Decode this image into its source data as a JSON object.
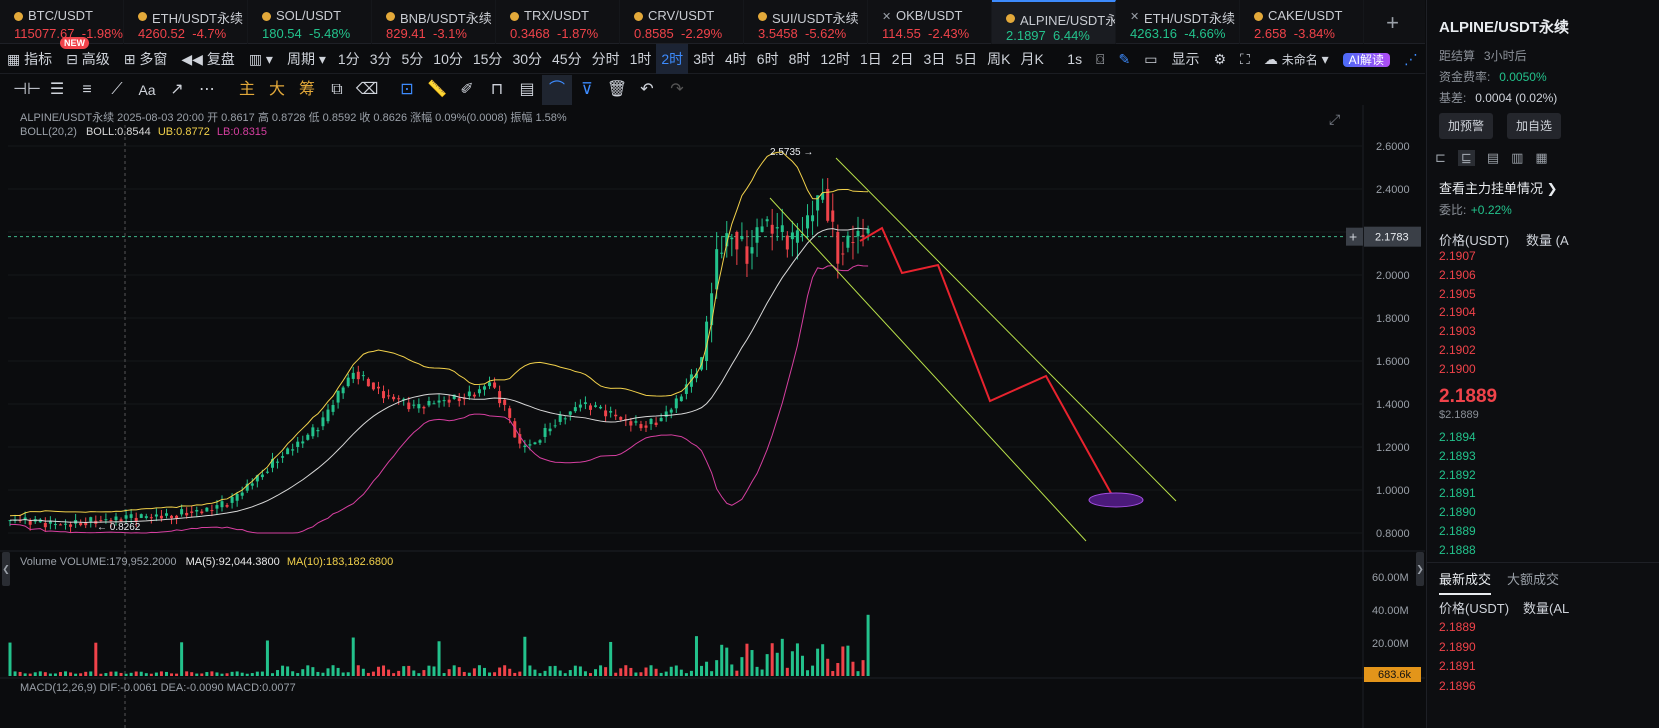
{
  "tickers": [
    {
      "sym": "BTC/USDT",
      "price": "115077.67",
      "chg": "-1.98%",
      "dir": "dn"
    },
    {
      "sym": "ETH/USDT永续",
      "price": "4260.52",
      "chg": "-4.7%",
      "dir": "dn"
    },
    {
      "sym": "SOL/USDT",
      "price": "180.54",
      "chg": "-5.48%",
      "dir": "up"
    },
    {
      "sym": "BNB/USDT永续",
      "price": "829.41",
      "chg": "-3.1%",
      "dir": "dn"
    },
    {
      "sym": "TRX/USDT",
      "price": "0.3468",
      "chg": "-1.87%",
      "dir": "dn"
    },
    {
      "sym": "CRV/USDT",
      "price": "0.8585",
      "chg": "-2.29%",
      "dir": "dn"
    },
    {
      "sym": "SUI/USDT永续",
      "price": "3.5458",
      "chg": "-5.62%",
      "dir": "dn"
    },
    {
      "sym": "OKB/USDT",
      "price": "114.55",
      "chg": "-2.43%",
      "dir": "dn"
    },
    {
      "sym": "ALPINE/USDT永续",
      "price": "2.1897",
      "chg": "6.44%",
      "dir": "up"
    },
    {
      "sym": "ETH/USDT永续",
      "price": "4263.16",
      "chg": "-4.66%",
      "dir": "up"
    },
    {
      "sym": "CAKE/USDT",
      "price": "2.658",
      "chg": "-3.84%",
      "dir": "dn"
    }
  ],
  "toolbar": {
    "indicators": "指标",
    "new_badge": "NEW",
    "advanced": "高级",
    "multiwin": "多窗",
    "replay": "复盘",
    "period": "周期",
    "intervals": [
      "1分",
      "3分",
      "5分",
      "10分",
      "15分",
      "30分",
      "45分",
      "分时",
      "1时",
      "2时",
      "3时",
      "4时",
      "6时",
      "8时",
      "12时",
      "1日",
      "2日",
      "3日",
      "5日",
      "周K",
      "月K"
    ],
    "active_interval": "2时",
    "sec": "1s",
    "display": "显示",
    "unnamed": "未命名",
    "ai": "AI解读"
  },
  "drawtools": {
    "zhu": "主",
    "da": "大",
    "chou": "筹",
    "aa": "Aa"
  },
  "legend": {
    "line1": "ALPINE/USDT永续  2025-08-03 20:00  开 0.8617  高 0.8728  低 0.8592  收 0.8626  涨幅 0.09%(0.0008)  振幅 1.58%",
    "boll": "BOLL(20,2)",
    "boll_mid": "BOLL:0.8544",
    "boll_ub": "UB:0.8772",
    "boll_lb": "LB:0.8315",
    "vol": "Volume  VOLUME:179,952.2000",
    "ma5": "MA(5):92,044.3800",
    "ma10": "MA(10):183,182.6800",
    "macd": "MACD(12,26,9)  DIF:-0.0061  DEA:-0.0090  MACD:0.0077"
  },
  "chart_labels": {
    "high": "2.5735 →",
    "low": "← 0.8262",
    "current": "2.1783",
    "vol_last": "683.6k"
  },
  "price_axis": [
    "2.6000",
    "2.4000",
    "2.2000",
    "2.0000",
    "1.8000",
    "1.6000",
    "1.4000",
    "1.2000",
    "1.0000",
    "0.8000"
  ],
  "vol_axis": [
    "60.00M",
    "40.00M",
    "20.00M"
  ],
  "colors": {
    "up": "#23c28c",
    "down": "#f0434a",
    "accent": "#3d8bfd",
    "boll_ub": "#f2d14b",
    "boll_mid": "#d8d8d8",
    "boll_lb": "#d63fa0",
    "drawing": "#e8232e",
    "channel": "#b8e04a"
  },
  "chart_data": {
    "type": "candlestick",
    "symbol": "ALPINE/USDT永续",
    "interval": "2时",
    "ylim": [
      0.78,
      2.66
    ],
    "close_path": [
      0.86,
      0.85,
      0.84,
      0.84,
      0.85,
      0.86,
      0.86,
      0.87,
      0.87,
      0.88,
      0.88,
      0.9,
      0.9,
      0.92,
      0.95,
      1.02,
      1.08,
      1.15,
      1.2,
      1.25,
      1.32,
      1.45,
      1.55,
      1.5,
      1.44,
      1.42,
      1.38,
      1.4,
      1.42,
      1.43,
      1.45,
      1.5,
      1.38,
      1.2,
      1.22,
      1.3,
      1.35,
      1.4,
      1.38,
      1.35,
      1.32,
      1.3,
      1.32,
      1.38,
      1.48,
      1.6,
      2.1,
      2.2,
      2.1,
      2.25,
      2.2,
      2.15,
      2.25,
      2.4,
      2.1,
      2.18,
      2.2
    ],
    "annotations": {
      "high": 2.5735,
      "low": 0.8262,
      "last": 2.1783
    }
  },
  "panel": {
    "title": "ALPINE/USDT永续",
    "settle_label": "距结算",
    "settle": "3小时后",
    "funding_label": "资金费率:",
    "funding": "0.0050%",
    "basis_label": "基差:",
    "basis": "0.0004 (0.02%)",
    "alert": "加预警",
    "watch": "加自选",
    "book_title": "查看主力挂单情况",
    "ratio_label": "委比:",
    "ratio": "+0.22%",
    "price_hdr": "价格(USDT)",
    "qty_hdr": "数量 (A",
    "asks": [
      "2.1907",
      "2.1906",
      "2.1905",
      "2.1904",
      "2.1903",
      "2.1902",
      "2.1900"
    ],
    "last": "2.1889",
    "last_sub": "$2.1889",
    "bids": [
      "2.1894",
      "2.1893",
      "2.1892",
      "2.1891",
      "2.1890",
      "2.1889",
      "2.1888"
    ],
    "trades_tab": "最新成交",
    "big_tab": "大额成交",
    "trades_price_hdr": "价格(USDT)",
    "trades_qty_hdr": "数量(AL",
    "trades": [
      "2.1889",
      "2.1890",
      "2.1891",
      "2.1896"
    ]
  }
}
